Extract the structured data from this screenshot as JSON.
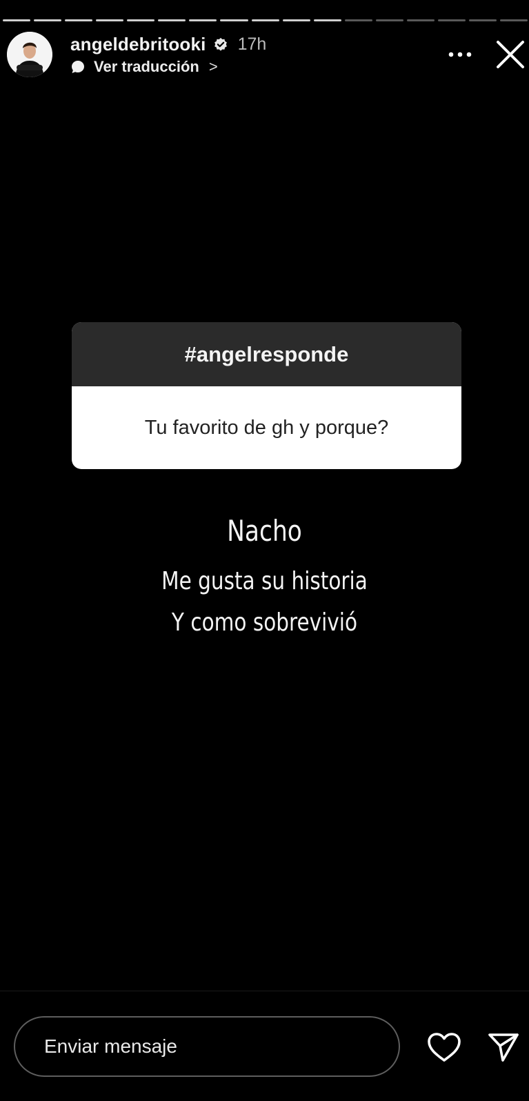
{
  "story": {
    "progress_segments": 17,
    "progress_completed": 11
  },
  "header": {
    "username": "angeldebritooki",
    "verified": true,
    "time_ago": "17h",
    "translate_label": "Ver traducción",
    "translate_chevron": ">",
    "more_icon": "more-horizontal-icon",
    "close_icon": "close-icon"
  },
  "question_sticker": {
    "tag": "#angelresponde",
    "question": "Tu favorito de gh y porque?"
  },
  "answer": {
    "title": "Nacho",
    "line1": "Me gusta su historia",
    "line2": "Y como sobrevivió"
  },
  "footer": {
    "message_placeholder": "Enviar mensaje",
    "like_icon": "heart-icon",
    "send_icon": "send-icon"
  },
  "colors": {
    "background": "#000000",
    "sticker_header": "#2b2b2b",
    "sticker_body": "#ffffff"
  }
}
